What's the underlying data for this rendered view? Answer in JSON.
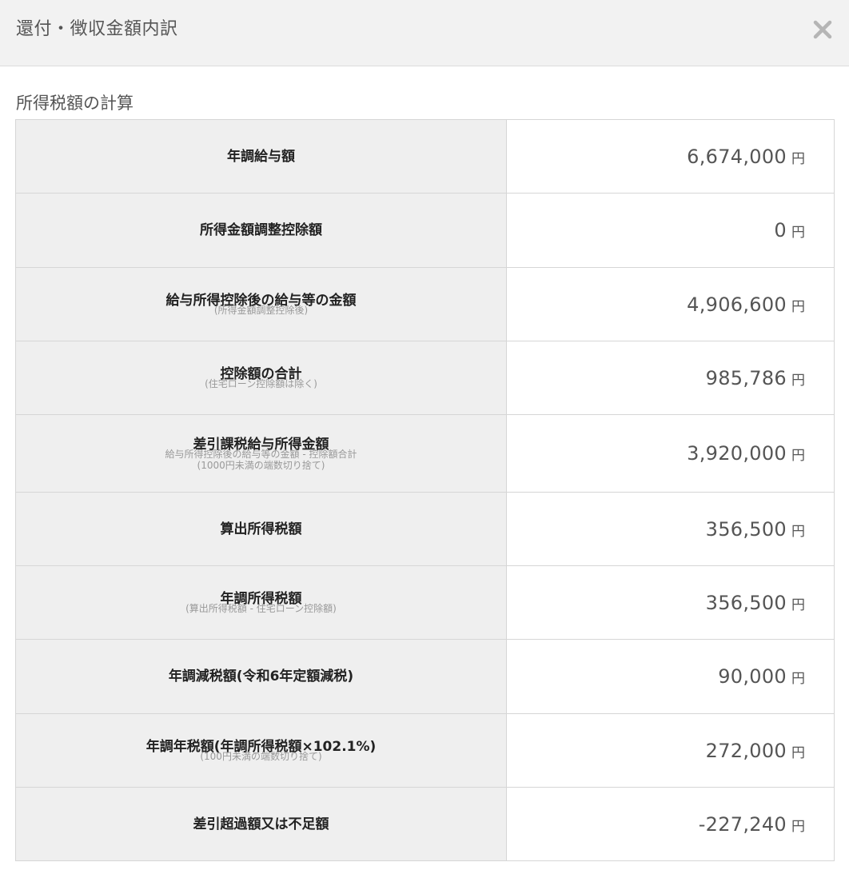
{
  "modal": {
    "title": "還付・徴収金額内訳",
    "close_icon": "close-icon"
  },
  "section": {
    "title": "所得税額の計算"
  },
  "rows": [
    {
      "label": "年調給与額",
      "sub1": "",
      "sub2": "",
      "value": "6,674,000",
      "unit": "円"
    },
    {
      "label": "所得金額調整控除額",
      "sub1": "",
      "sub2": "",
      "value": "0",
      "unit": "円"
    },
    {
      "label": "給与所得控除後の給与等の金額",
      "sub1": "(所得金額調整控除後)",
      "sub2": "",
      "value": "4,906,600",
      "unit": "円"
    },
    {
      "label": "控除額の合計",
      "sub1": "(住宅ローン控除額は除く)",
      "sub2": "",
      "value": "985,786",
      "unit": "円"
    },
    {
      "label": "差引課税給与所得金額",
      "sub1": "給与所得控除後の給与等の金額 - 控除額合計",
      "sub2": "(1000円未満の端数切り捨て)",
      "value": "3,920,000",
      "unit": "円"
    },
    {
      "label": "算出所得税額",
      "sub1": "",
      "sub2": "",
      "value": "356,500",
      "unit": "円"
    },
    {
      "label": "年調所得税額",
      "sub1": "(算出所得税額 - 住宅ローン控除額)",
      "sub2": "",
      "value": "356,500",
      "unit": "円"
    },
    {
      "label": "年調減税額(令和6年定額減税)",
      "sub1": "",
      "sub2": "",
      "value": "90,000",
      "unit": "円"
    },
    {
      "label": "年調年税額(年調所得税額×102.1%)",
      "sub1": "(100円未満の端数切り捨て)",
      "sub2": "",
      "value": "272,000",
      "unit": "円"
    },
    {
      "label": "差引超過額又は不足額",
      "sub1": "",
      "sub2": "",
      "value": "-227,240",
      "unit": "円"
    }
  ]
}
